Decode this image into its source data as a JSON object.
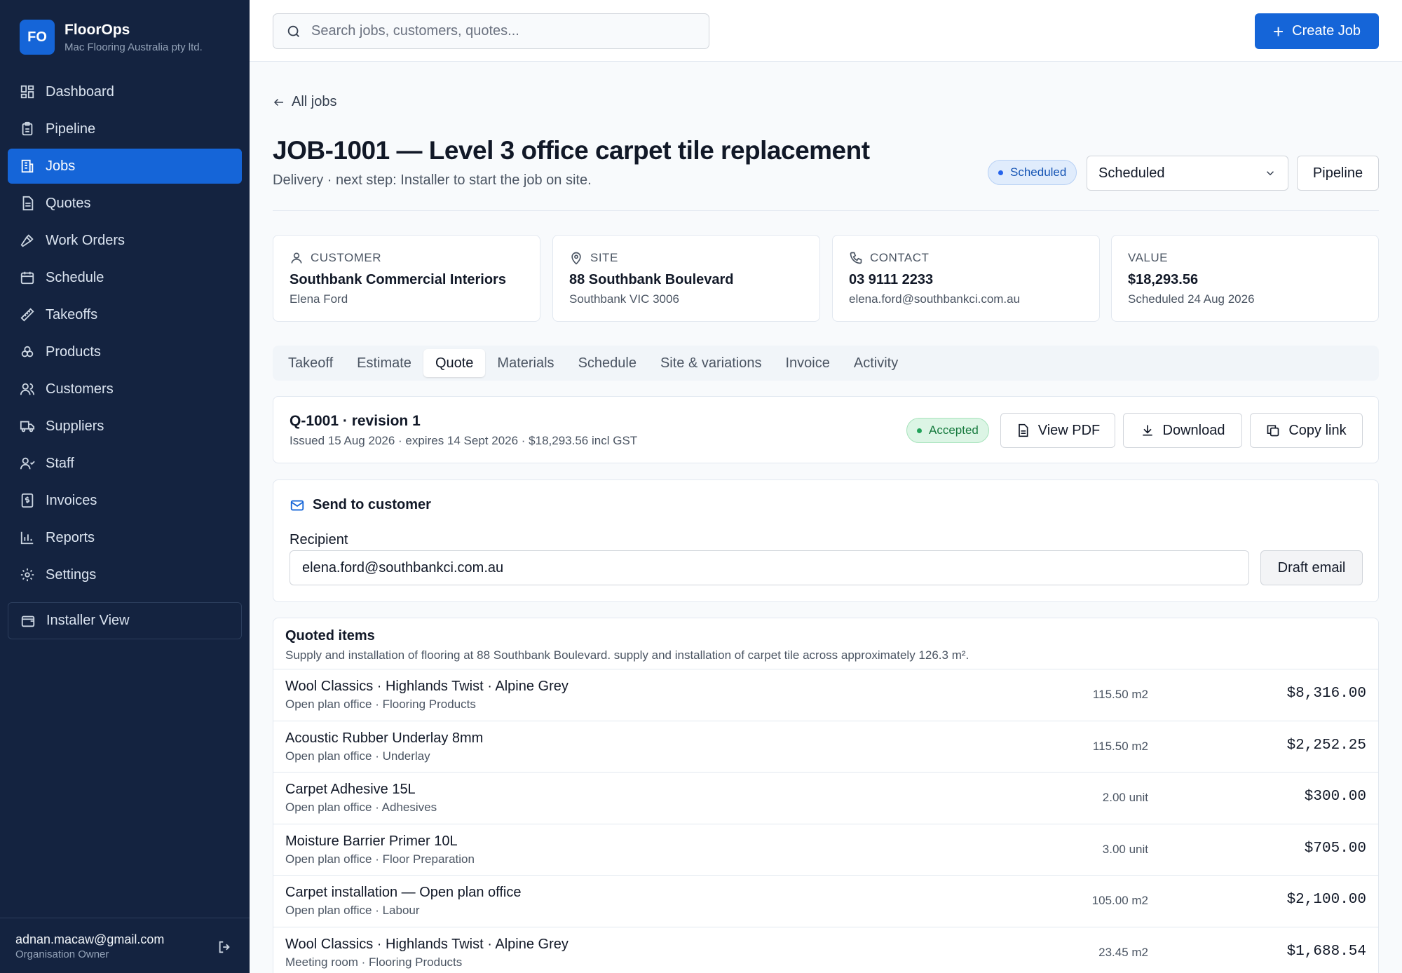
{
  "brand": {
    "initials": "FO",
    "name": "FloorOps",
    "org": "Mac Flooring Australia pty ltd."
  },
  "sidebar": {
    "items": [
      {
        "label": "Dashboard",
        "icon": "dashboard-icon"
      },
      {
        "label": "Pipeline",
        "icon": "clipboard-icon"
      },
      {
        "label": "Jobs",
        "icon": "building-icon",
        "active": true
      },
      {
        "label": "Quotes",
        "icon": "file-icon"
      },
      {
        "label": "Work Orders",
        "icon": "hammer-icon"
      },
      {
        "label": "Schedule",
        "icon": "calendar-icon"
      },
      {
        "label": "Takeoffs",
        "icon": "ruler-icon"
      },
      {
        "label": "Products",
        "icon": "boxes-icon"
      },
      {
        "label": "Customers",
        "icon": "users-icon"
      },
      {
        "label": "Suppliers",
        "icon": "truck-icon"
      },
      {
        "label": "Staff",
        "icon": "staff-icon"
      },
      {
        "label": "Invoices",
        "icon": "receipt-icon"
      },
      {
        "label": "Reports",
        "icon": "bar-chart-icon"
      },
      {
        "label": "Settings",
        "icon": "gear-icon"
      }
    ],
    "installer_view": "Installer View",
    "user_email": "adnan.macaw@gmail.com",
    "user_role": "Organisation Owner"
  },
  "topbar": {
    "search_placeholder": "Search jobs, customers, quotes...",
    "create_label": "Create Job"
  },
  "job": {
    "back_label": "All jobs",
    "title": "JOB-1001 — Level 3 office carpet tile replacement",
    "subtitle": "Delivery · next step: Installer to start the job on site.",
    "status_badge": "Scheduled",
    "status_select": "Scheduled",
    "pipeline_label": "Pipeline"
  },
  "cards": {
    "customer": {
      "label": "CUSTOMER",
      "main": "Southbank Commercial Interiors",
      "sub": "Elena Ford"
    },
    "site": {
      "label": "SITE",
      "main": "88 Southbank Boulevard",
      "sub": "Southbank VIC 3006"
    },
    "contact": {
      "label": "CONTACT",
      "main": "03 9111 2233",
      "sub": "elena.ford@southbankci.com.au"
    },
    "value": {
      "label": "VALUE",
      "main": "$18,293.56",
      "sub": "Scheduled 24 Aug 2026"
    }
  },
  "tabs": [
    "Takeoff",
    "Estimate",
    "Quote",
    "Materials",
    "Schedule",
    "Site & variations",
    "Invoice",
    "Activity"
  ],
  "active_tab": "Quote",
  "quote": {
    "id": "Q-1001 · revision 1",
    "meta": "Issued 15 Aug 2026 · expires 14 Sept 2026 · $18,293.56 incl GST",
    "status": "Accepted",
    "view_pdf": "View PDF",
    "download": "Download",
    "copy_link": "Copy link"
  },
  "send": {
    "title": "Send to customer",
    "recipient_label": "Recipient",
    "recipient_value": "elena.ford@southbankci.com.au",
    "draft_label": "Draft email"
  },
  "items": {
    "title": "Quoted items",
    "description": "Supply and installation of flooring at 88 Southbank Boulevard. supply and installation of carpet tile across approximately 126.3 m².",
    "rows": [
      {
        "name": "Wool Classics · Highlands Twist · Alpine Grey",
        "sub": "Open plan office · Flooring Products",
        "qty": "115.50 m2",
        "amount": "$8,316.00"
      },
      {
        "name": "Acoustic Rubber Underlay 8mm",
        "sub": "Open plan office · Underlay",
        "qty": "115.50 m2",
        "amount": "$2,252.25"
      },
      {
        "name": "Carpet Adhesive 15L",
        "sub": "Open plan office · Adhesives",
        "qty": "2.00 unit",
        "amount": "$300.00"
      },
      {
        "name": "Moisture Barrier Primer 10L",
        "sub": "Open plan office · Floor Preparation",
        "qty": "3.00 unit",
        "amount": "$705.00"
      },
      {
        "name": "Carpet installation — Open plan office",
        "sub": "Open plan office · Labour",
        "qty": "105.00 m2",
        "amount": "$2,100.00"
      },
      {
        "name": "Wool Classics · Highlands Twist · Alpine Grey",
        "sub": "Meeting room · Flooring Products",
        "qty": "23.45 m2",
        "amount": "$1,688.54"
      }
    ]
  },
  "colors": {
    "sidebar_bg": "#142340",
    "accent": "#1565d8",
    "accepted_bg": "#dcf5e5",
    "scheduled_bg": "#e0ecfc"
  }
}
